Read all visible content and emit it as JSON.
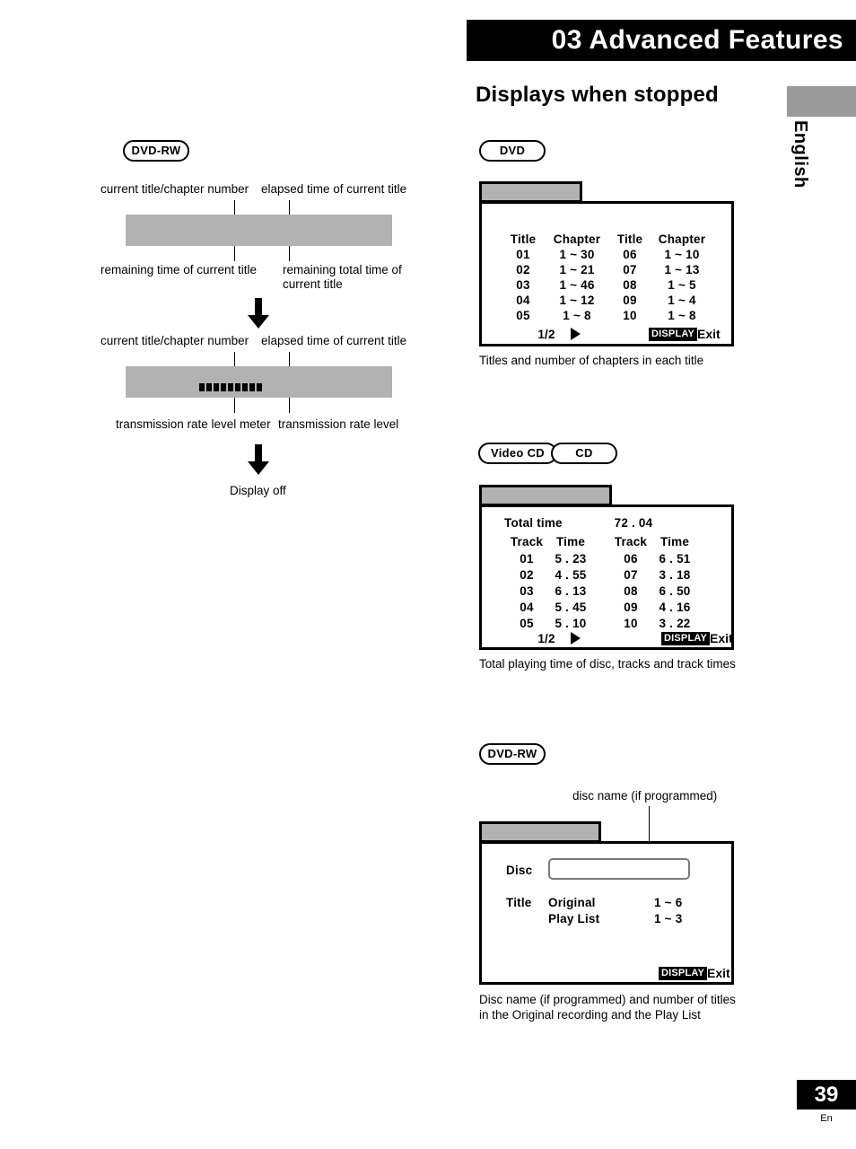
{
  "header": {
    "chapter_title": "03 Advanced Features",
    "language_tab": "English",
    "section_title": "Displays when stopped"
  },
  "left_column": {
    "badge": "DVD-RW",
    "diagram1": {
      "label_top_left": "current title/chapter number",
      "label_top_right": "elapsed time of current title",
      "label_bottom_left": "remaining time of current title",
      "label_bottom_right_line1": "remaining total time of",
      "label_bottom_right_line2": "current title"
    },
    "diagram2": {
      "label_top_left": "current title/chapter number",
      "label_top_right": "elapsed time of current title",
      "label_bottom_left": "transmission rate level meter",
      "label_bottom_right": "transmission rate level",
      "meter_segments": 9
    },
    "display_off": "Display off"
  },
  "dvd_panel": {
    "badge": "DVD",
    "headers": [
      "Title",
      "Chapter",
      "Title",
      "Chapter"
    ],
    "rows": [
      [
        "01",
        "1 ~ 30",
        "06",
        "1 ~ 10"
      ],
      [
        "02",
        "1 ~ 21",
        "07",
        "1 ~ 13"
      ],
      [
        "03",
        "1 ~ 46",
        "08",
        "1 ~ 5"
      ],
      [
        "04",
        "1 ~ 12",
        "09",
        "1 ~ 4"
      ],
      [
        "05",
        "1 ~ 8",
        "10",
        "1 ~ 8"
      ]
    ],
    "page_indicator": "1/2",
    "display_button": "DISPLAY",
    "exit_label": "Exit",
    "caption": "Titles and number of chapters in each title"
  },
  "cd_panel": {
    "badge_video_cd": "Video CD",
    "badge_cd": "CD",
    "total_time_label": "Total time",
    "total_time_value": "72 . 04",
    "headers": [
      "Track",
      "Time",
      "Track",
      "Time"
    ],
    "rows": [
      [
        "01",
        "5 . 23",
        "06",
        "6 . 51"
      ],
      [
        "02",
        "4 . 55",
        "07",
        "3 . 18"
      ],
      [
        "03",
        "6 . 13",
        "08",
        "6 . 50"
      ],
      [
        "04",
        "5 . 45",
        "09",
        "4 . 16"
      ],
      [
        "05",
        "5 . 10",
        "10",
        "3 . 22"
      ]
    ],
    "page_indicator": "1/2",
    "display_button": "DISPLAY",
    "exit_label": "Exit",
    "caption": "Total playing time of disc, tracks and track times"
  },
  "dvdrw_panel": {
    "badge": "DVD-RW",
    "callout": "disc name (if programmed)",
    "disc_label": "Disc",
    "disc_value": "",
    "title_label": "Title",
    "rows": [
      [
        "Original",
        "1 ~ 6"
      ],
      [
        "Play List",
        "1 ~ 3"
      ]
    ],
    "display_button": "DISPLAY",
    "exit_label": "Exit",
    "caption_line1": "Disc name (if programmed) and number of titles",
    "caption_line2": "in the Original recording and the Play List"
  },
  "footer": {
    "page_number": "39",
    "page_lang": "En"
  },
  "colors": {
    "grey_bar": "#b2b2b2",
    "black": "#000000",
    "white": "#ffffff"
  }
}
